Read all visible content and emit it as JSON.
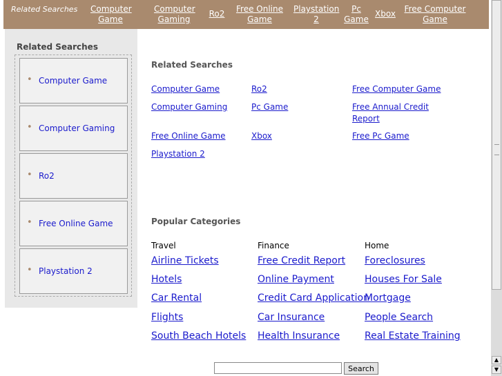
{
  "topbar": {
    "label": "Related Searches",
    "links": [
      "Computer Game",
      "Computer Gaming",
      "Ro2",
      "Free Online Game",
      "Playstation 2",
      "Pc Game",
      "Xbox",
      "Free Computer Game"
    ]
  },
  "sidebar": {
    "title": "Related Searches",
    "items": [
      "Computer Game",
      "Computer Gaming",
      "Ro2",
      "Free Online Game",
      "Playstation 2"
    ]
  },
  "related": {
    "title": "Related Searches",
    "links": [
      "Computer Game",
      "Ro2",
      "Free Computer Game",
      "Computer Gaming",
      "Pc Game",
      "Free Annual Credit Report",
      "Free Online Game",
      "Xbox",
      "Free Pc Game",
      "Playstation 2"
    ]
  },
  "popular": {
    "title": "Popular Categories",
    "columns": [
      {
        "heading": "Travel",
        "links": [
          "Airline Tickets",
          "Hotels",
          "Car Rental",
          "Flights",
          "South Beach Hotels"
        ]
      },
      {
        "heading": "Finance",
        "links": [
          "Free Credit Report",
          "Online Payment",
          "Credit Card Application",
          "Car Insurance",
          "Health Insurance"
        ]
      },
      {
        "heading": "Home",
        "links": [
          "Foreclosures",
          "Houses For Sale",
          "Mortgage",
          "People Search",
          "Real Estate Training"
        ]
      }
    ]
  },
  "search": {
    "input_value": "",
    "button_label": "Search"
  },
  "scrollbar": {
    "up_arrow": "▲",
    "down_arrow": "▼"
  }
}
